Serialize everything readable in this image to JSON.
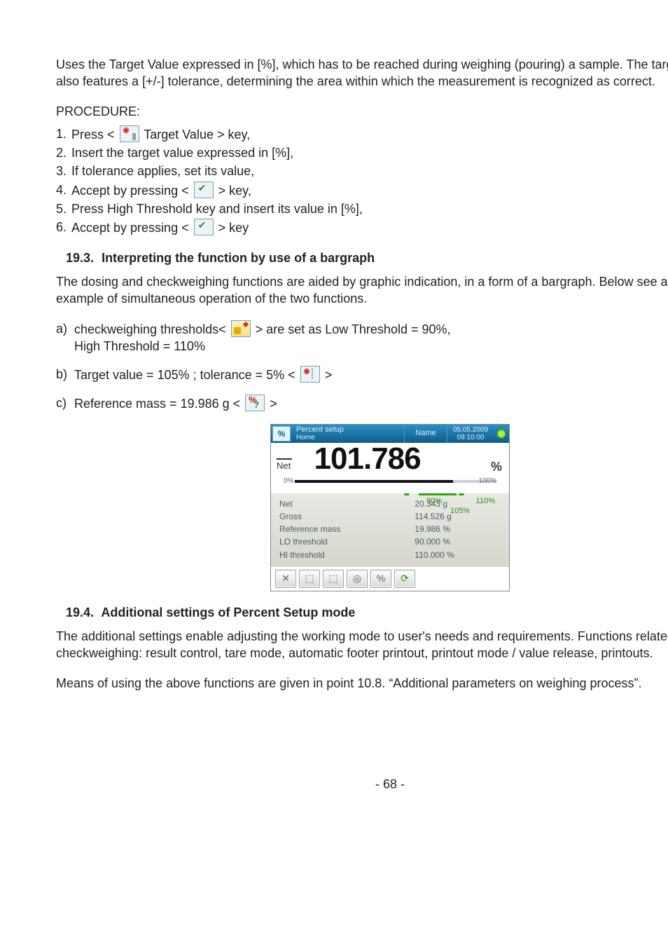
{
  "intro_para": "Uses the Target Value expressed in [%], which has to be reached during weighing (pouring) a sample. The target value also features a [+/-] tolerance, determining the area within which the measurement is recognized as correct.",
  "procedure_label": "PROCEDURE:",
  "steps": {
    "s1a": "Press <",
    "s1b": " Target Value > key,",
    "s2": "Insert the target value expressed in [%],",
    "s3": "If tolerance applies, set its value,",
    "s4a": "Accept by pressing <",
    "s4b": "> key,",
    "s5": "Press High Threshold key and insert its value in [%],",
    "s6a": "Accept by pressing <",
    "s6b": "> key"
  },
  "sec193_num": "19.3.",
  "sec193_title": "Interpreting the function by use of a bargraph",
  "sec193_para": "The dosing and checkweighing functions are aided by graphic indication, in a form of a bargraph. Below see an example of simultaneous operation of the two functions.",
  "items": {
    "a_lead": "a)",
    "a1a": "checkweighing thresholds<",
    "a1b": "> are set as Low Threshold = 90%,",
    "a2": "High Threshold = 110%",
    "b_lead": "b)",
    "b1a": "Target value = 105% ; tolerance = 5% <",
    "b1b": ">",
    "c_lead": "c)",
    "c1a": "Reference mass = 19.986 g <",
    "c1b": ">"
  },
  "device": {
    "header_icon": "%",
    "title1": "Percent setup",
    "title2": "Home",
    "name_label": "Name",
    "date1": "05.05.2009",
    "date2": "09:10:00",
    "net_label": "Net",
    "reading": "101.786",
    "unit": "%",
    "scale_0": "0%",
    "scale_100": "100%",
    "rows": [
      {
        "k": "Net",
        "v": "20.343 g"
      },
      {
        "k": "Gross",
        "v": "114.526 g"
      },
      {
        "k": "Reference mass",
        "v": "19.986 %"
      },
      {
        "k": "LO threshold",
        "v": "90.000 %"
      },
      {
        "k": "HI threshold",
        "v": "110.000 %"
      }
    ],
    "mk90": "90%",
    "mk105": "105%",
    "mk110": "110%"
  },
  "sec194_num": "19.4.",
  "sec194_title": "Additional settings of Percent Setup mode",
  "sec194_para": "The additional settings enable adjusting the working mode to user's needs and requirements. Functions related to checkweighing: result control, tare mode, automatic footer printout, printout mode / value release, printouts.",
  "sec194_para2": "Means of using the above functions are given in point 10.8. “Additional parameters on weighing process”.",
  "page_number": "- 68 -"
}
